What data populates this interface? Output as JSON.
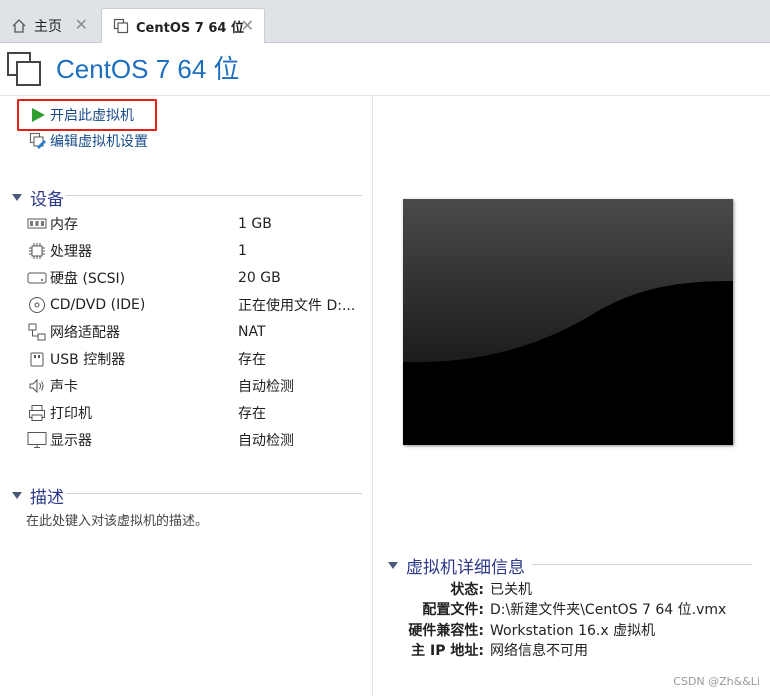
{
  "tabs": [
    {
      "label": "主页",
      "icon": "home-icon"
    },
    {
      "label": "CentOS 7 64 位",
      "icon": "vm-icon"
    }
  ],
  "close_glyph": "✕",
  "title": "CentOS 7 64 位",
  "actions": {
    "power_on": "开启此虚拟机",
    "edit_settings": "编辑虚拟机设置"
  },
  "devices": {
    "heading": "设备",
    "items": [
      {
        "name": "内存",
        "value": "1 GB",
        "icon": "memory-icon"
      },
      {
        "name": "处理器",
        "value": "1",
        "icon": "cpu-icon"
      },
      {
        "name": "硬盘 (SCSI)",
        "value": "20 GB",
        "icon": "disk-icon"
      },
      {
        "name": "CD/DVD (IDE)",
        "value": "正在使用文件 D:...",
        "icon": "cdrom-icon"
      },
      {
        "name": "网络适配器",
        "value": "NAT",
        "icon": "network-icon"
      },
      {
        "name": "USB 控制器",
        "value": "存在",
        "icon": "usb-icon"
      },
      {
        "name": "声卡",
        "value": "自动检测",
        "icon": "speaker-icon"
      },
      {
        "name": "打印机",
        "value": "存在",
        "icon": "printer-icon"
      },
      {
        "name": "显示器",
        "value": "自动检测",
        "icon": "monitor-icon"
      }
    ]
  },
  "description": {
    "heading": "描述",
    "placeholder": "在此处键入对该虚拟机的描述。"
  },
  "details": {
    "heading": "虚拟机详细信息",
    "rows": [
      {
        "key": "状态:",
        "value": "已关机"
      },
      {
        "key": "配置文件:",
        "value": "D:\\新建文件夹\\CentOS 7 64 位.vmx"
      },
      {
        "key": "硬件兼容性:",
        "value": "Workstation 16.x 虚拟机"
      },
      {
        "key": "主 IP 地址:",
        "value": "网络信息不可用"
      }
    ]
  },
  "watermark": "CSDN @Zh&&Li",
  "colors": {
    "title": "#1f6fbf",
    "highlight_box": "#e0201b",
    "play_green": "#2e9e2e"
  }
}
